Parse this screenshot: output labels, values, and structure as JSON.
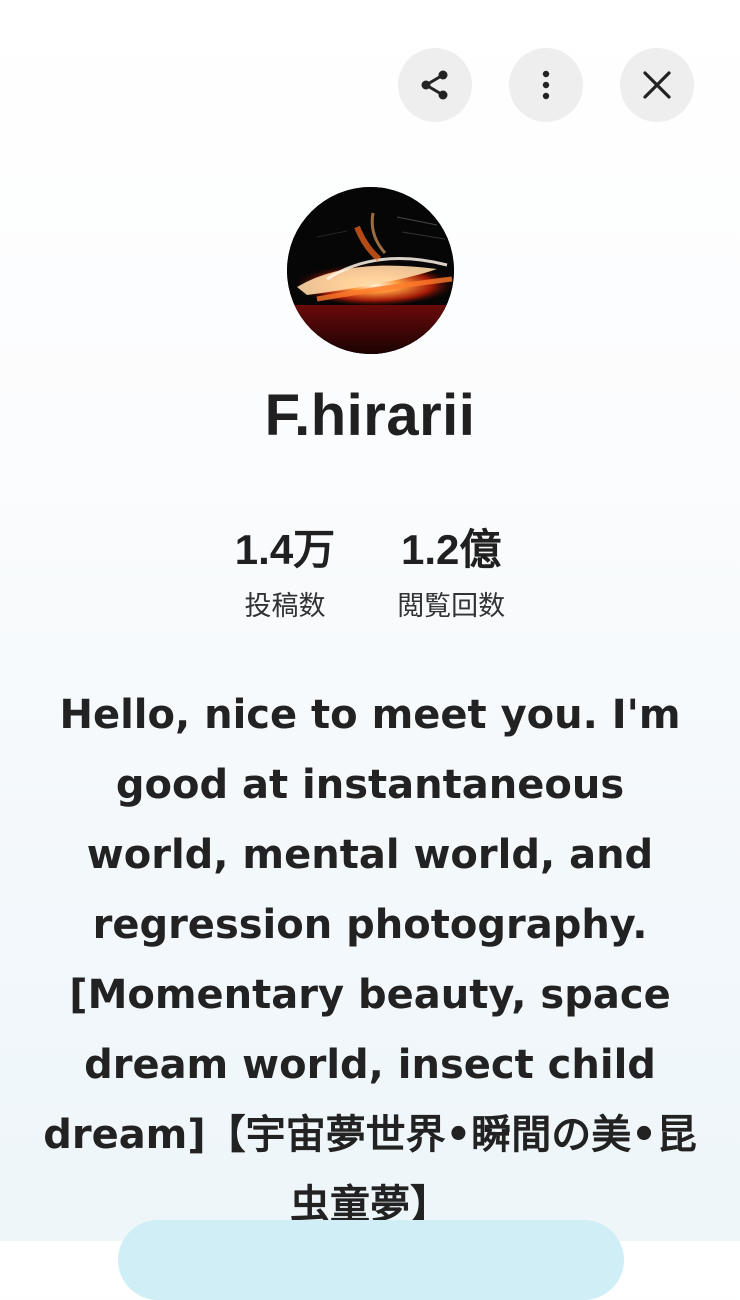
{
  "header": {
    "share_icon": "share-icon",
    "more_icon": "more-vert-icon",
    "close_icon": "close-icon"
  },
  "profile": {
    "avatar_icon": "light-streak-avatar",
    "username": "F.hirarii",
    "stats": [
      {
        "value": "1.4万",
        "label": "投稿数"
      },
      {
        "value": "1.2億",
        "label": "閲覧回数"
      }
    ],
    "bio": "Hello, nice to meet you. I'm good at instantaneous world, mental world, and regression photography. [Momentary beauty, space dream world, insect child dream]【宇宙夢世界•瞬間の美•昆虫童夢】"
  },
  "colors": {
    "button_bg": "#eeeeee",
    "follow_pill": "#cfeef6"
  }
}
